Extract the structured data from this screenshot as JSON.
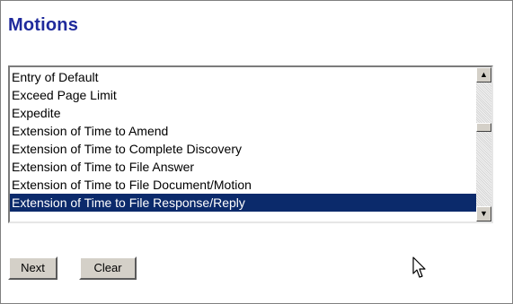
{
  "page": {
    "title": "Motions"
  },
  "motions_list": {
    "items": [
      "Entry of Default",
      "Exceed Page Limit",
      "Expedite",
      "Extension of Time to Amend",
      "Extension of Time to Complete Discovery",
      "Extension of Time to File Answer",
      "Extension of Time to File Document/Motion",
      "Extension of Time to File Response/Reply"
    ],
    "selected_item": "Extension of Time to File Response/Reply"
  },
  "buttons": {
    "next_label": "Next",
    "clear_label": "Clear"
  },
  "colors": {
    "title": "#1f2a9c",
    "selection_background": "#0b2a6b",
    "selection_text": "#ffffff",
    "button_face": "#d4d0c8"
  },
  "icons": {
    "scroll_up": "up-arrow-icon",
    "scroll_down": "down-arrow-icon",
    "cursor": "mouse-pointer-icon"
  }
}
